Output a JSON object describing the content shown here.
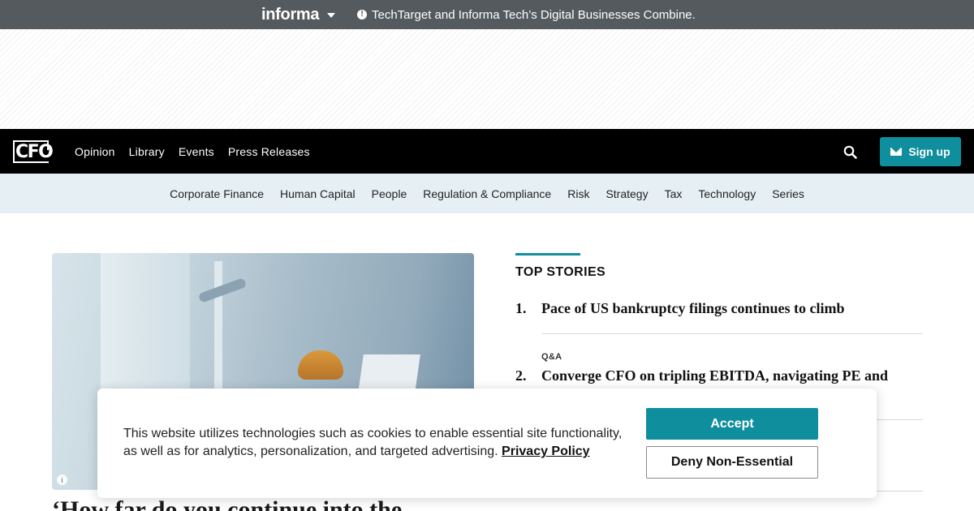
{
  "informa_bar": {
    "logo": "informa",
    "notice": "TechTarget and Informa Tech’s Digital Businesses Combine.",
    "icons": [
      "chevron-down-icon",
      "info-icon"
    ]
  },
  "main_nav": {
    "logo": "CFO",
    "links": [
      "Opinion",
      "Library",
      "Events",
      "Press Releases"
    ],
    "search_icon": "search-icon",
    "signup_label": "Sign up",
    "signup_icon": "mail-icon"
  },
  "category_nav": {
    "links": [
      "Corporate Finance",
      "Human Capital",
      "People",
      "Regulation & Compliance",
      "Risk",
      "Strategy",
      "Tax",
      "Technology",
      "Series"
    ]
  },
  "hero": {
    "headline_peek": "‘How far do you continue into the"
  },
  "top_stories": {
    "heading": "TOP STORIES",
    "items": [
      {
        "number": "1.",
        "kicker": "",
        "title": "Pace of US bankruptcy filings continues to climb"
      },
      {
        "number": "2.",
        "kicker": "Q&A",
        "title": "Converge CFO on tripling EBITDA, navigating PE and"
      }
    ]
  },
  "cookie_banner": {
    "text": "This website utilizes technologies such as cookies to enable essential site functionality, as well as for analytics, personalization, and targeted advertising.",
    "privacy_link": "Privacy Policy",
    "accept_label": "Accept",
    "deny_label": "Deny Non-Essential"
  },
  "colors": {
    "accent": "#0f8e9e",
    "informa_bar": "#545a5e",
    "nav_bg": "#000000",
    "category_bg": "#e6f0f4"
  }
}
